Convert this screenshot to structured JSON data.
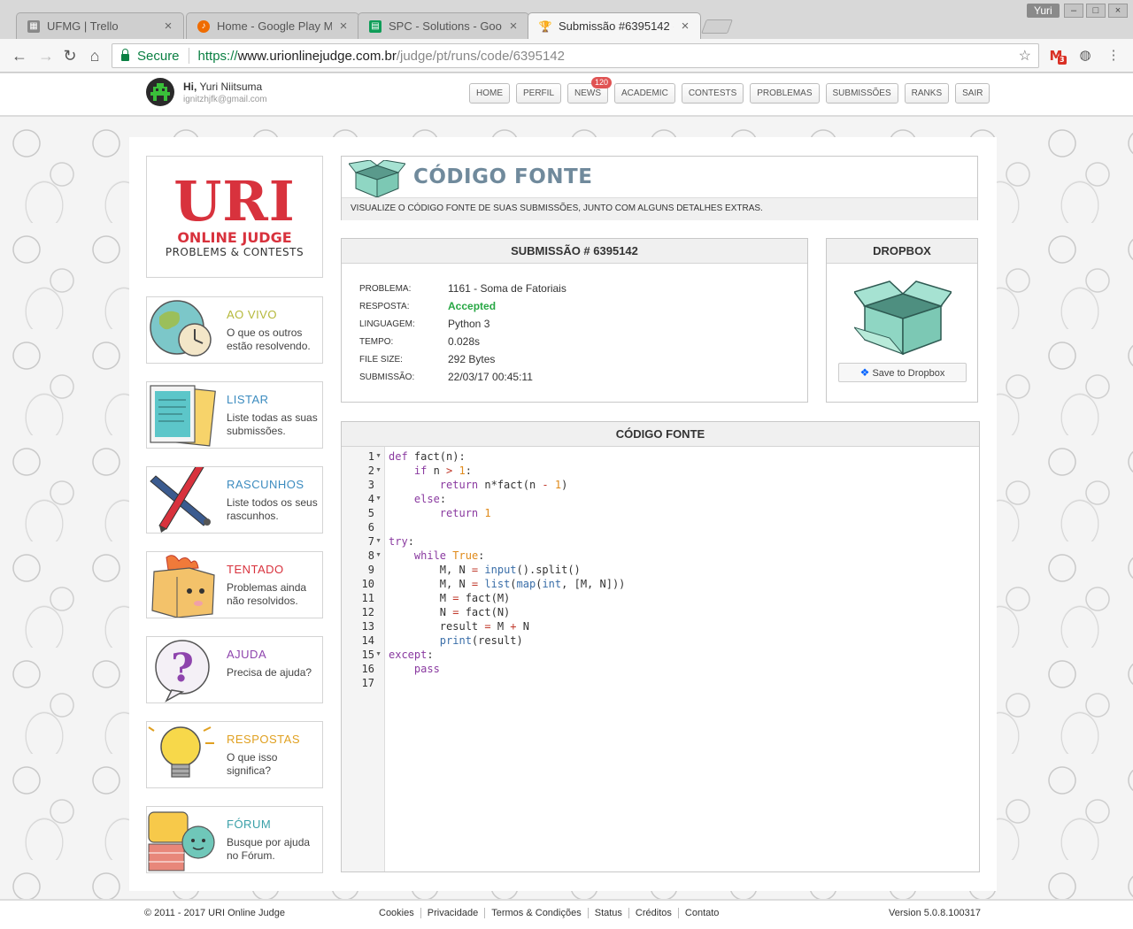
{
  "browser": {
    "tabs": [
      {
        "label": "UFMG | Trello",
        "icon": "trello-icon",
        "active": false
      },
      {
        "label": "Home - Google Play Mú",
        "icon": "google-play-music-icon",
        "active": false
      },
      {
        "label": "SPC - Solutions - Google",
        "icon": "google-sheets-icon",
        "active": false
      },
      {
        "label": "Submissão #6395142 -",
        "icon": "uri-trophy-icon",
        "active": true
      }
    ],
    "profile_name": "Yuri",
    "secure_label": "Secure",
    "url_scheme": "https://",
    "url_host": "www.urionlinejudge.com.br",
    "url_path": "/judge/pt/runs/code/6395142",
    "gmail_count": "3"
  },
  "header": {
    "greeting": "Hi,",
    "user_name": "Yuri Niitsuma",
    "user_email": "ignitzhjfk@gmail.com",
    "nav": [
      "HOME",
      "PERFIL",
      "NEWS",
      "ACADEMIC",
      "CONTESTS",
      "PROBLEMAS",
      "SUBMISSÕES",
      "RANKS",
      "SAIR"
    ],
    "news_badge": "120"
  },
  "logo": {
    "main": "URI",
    "line1": "ONLINE JUDGE",
    "line2": "PROBLEMS & CONTESTS"
  },
  "sidebar": [
    {
      "title": "AO VIVO",
      "desc": "O que os outros estão resolvendo.",
      "color": "#b5b83a"
    },
    {
      "title": "LISTAR",
      "desc": "Liste todas as suas submissões.",
      "color": "#3b8bbf"
    },
    {
      "title": "RASCUNHOS",
      "desc": "Liste todos os seus rascunhos.",
      "color": "#3b8bbf"
    },
    {
      "title": "TENTADO",
      "desc": "Problemas ainda não resolvidos.",
      "color": "#d8323d"
    },
    {
      "title": "AJUDA",
      "desc": "Precisa de ajuda?",
      "color": "#8e44ad"
    },
    {
      "title": "RESPOSTAS",
      "desc": "O que isso significa?",
      "color": "#e0a020"
    },
    {
      "title": "FÓRUM",
      "desc": "Busque por ajuda no Fórum.",
      "color": "#3aa0a8"
    }
  ],
  "banner": {
    "title": "CÓDIGO FONTE",
    "subtitle": "VISUALIZE O CÓDIGO FONTE DE SUAS SUBMISSÕES, JUNTO COM ALGUNS DETALHES EXTRAS."
  },
  "submission": {
    "heading": "SUBMISSÃO # 6395142",
    "rows": [
      {
        "key": "PROBLEMA:",
        "value": "1161 - Soma de Fatoriais"
      },
      {
        "key": "RESPOSTA:",
        "value": "Accepted"
      },
      {
        "key": "LINGUAGEM:",
        "value": "Python 3"
      },
      {
        "key": "TEMPO:",
        "value": "0.028s"
      },
      {
        "key": "FILE SIZE:",
        "value": "292 Bytes"
      },
      {
        "key": "SUBMISSÃO:",
        "value": "22/03/17 00:45:11"
      }
    ]
  },
  "dropbox": {
    "heading": "DROPBOX",
    "button_label": "Save to Dropbox"
  },
  "code": {
    "heading": "CÓDIGO FONTE",
    "lines": [
      "def fact(n):",
      "    if n > 1:",
      "        return n*fact(n - 1)",
      "    else:",
      "        return 1",
      "",
      "try:",
      "    while True:",
      "        M, N = input().split()",
      "        M, N = list(map(int, [M, N]))",
      "        M = fact(M)",
      "        N = fact(N)",
      "        result = M + N",
      "        print(result)",
      "except:",
      "    pass",
      ""
    ],
    "fold_lines": [
      1,
      2,
      4,
      7,
      8,
      15
    ]
  },
  "footer": {
    "copyright": "© 2011 - 2017 URI Online Judge",
    "links": [
      "Cookies",
      "Privacidade",
      "Termos & Condições",
      "Status",
      "Créditos",
      "Contato"
    ],
    "version": "Version 5.0.8.100317"
  }
}
